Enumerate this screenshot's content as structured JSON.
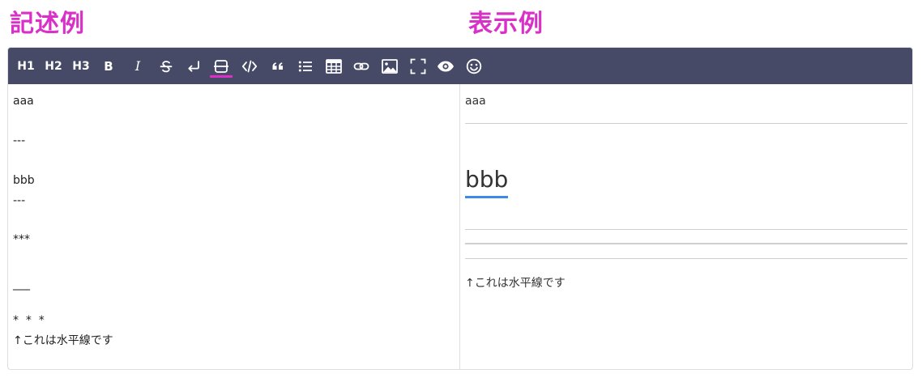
{
  "headings": {
    "left": "記述例",
    "right": "表示例"
  },
  "toolbar": {
    "buttons": [
      {
        "label": "H1",
        "icon": "heading-1-icon"
      },
      {
        "label": "H2",
        "icon": "heading-2-icon"
      },
      {
        "label": "H3",
        "icon": "heading-3-icon"
      },
      {
        "label": "B",
        "icon": "bold-icon"
      },
      {
        "label": "I",
        "icon": "italic-icon"
      },
      {
        "label": "",
        "icon": "strikethrough-icon"
      },
      {
        "label": "",
        "icon": "line-break-icon"
      },
      {
        "label": "",
        "icon": "horizontal-rule-icon"
      },
      {
        "label": "",
        "icon": "code-icon"
      },
      {
        "label": "",
        "icon": "quote-icon"
      },
      {
        "label": "",
        "icon": "list-icon"
      },
      {
        "label": "",
        "icon": "table-icon"
      },
      {
        "label": "",
        "icon": "link-icon"
      },
      {
        "label": "",
        "icon": "image-icon"
      },
      {
        "label": "",
        "icon": "fullscreen-icon"
      },
      {
        "label": "",
        "icon": "preview-eye-icon"
      },
      {
        "label": "",
        "icon": "emoji-icon"
      }
    ],
    "active": "horizontal-rule-icon",
    "background": "#464a67",
    "active_underline_color": "#e02fc9"
  },
  "source": {
    "lines": [
      "aaa",
      "---",
      "bbb",
      "---",
      "***",
      "___",
      "*  *  *",
      "↑これは水平線です"
    ]
  },
  "preview": {
    "paragraph": "aaa",
    "heading": "bbb",
    "note": "↑これは水平線です",
    "heading_underline_color": "#3b8ce8"
  }
}
